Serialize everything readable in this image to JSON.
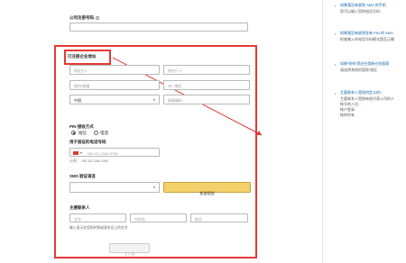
{
  "form": {
    "company_reg_no_label": "公司注册号码",
    "address_section_label": "已注册企业地址",
    "address_line1_placeholder": "地址行1",
    "address_line2_placeholder": "地址行 2",
    "city_placeholder": "城市/城镇",
    "state_placeholder": "州 / 地区",
    "country_value": "中国",
    "postal_placeholder": "邮政编码",
    "pin_method_label": "PIN 接收方式",
    "pin_option_sms": "短信",
    "pin_option_call": "电话",
    "phone_label": "用于验证的电话号码",
    "phone_placeholder": "+86 131 2345 6789",
    "phone_example": "示例：  +86 201 266 1000",
    "sms_lang_label": "SMS 验证语言",
    "sms_lang_value": "",
    "send_sms_button": "发送短信",
    "contact_section_label": "主要联系人",
    "first_name_placeholder": "名字",
    "middle_name_placeholder": "中间名",
    "last_name_placeholder": "姓氏",
    "name_hint": "输入显示在您的护照或身份证上的名字",
    "next_button": "下一步"
  },
  "sidebar": {
    "items": [
      {
        "q": "如果我没有收到 SMS 的手机",
        "a": "您可以输入您的电话号码..."
      },
      {
        "q": "如果我没有收到含有 PIN 的 SMS",
        "a": "检查输入的电话号码格式是否正确"
      },
      {
        "q": "如果“听听”您还在我所在的国家",
        "a": "请选择其他的国家/地区"
      },
      {
        "q": "主要联系人是如何定义的?",
        "a": "主要联系人是指有权代表公司的人"
      }
    ],
    "extra_lines": [
      "帐号的人员...",
      "帐户登录...",
      "帐的所有"
    ]
  },
  "colors": {
    "highlight": "#e53935",
    "send_button_bg": "#f4d06a",
    "link": "#0b5fa5"
  }
}
